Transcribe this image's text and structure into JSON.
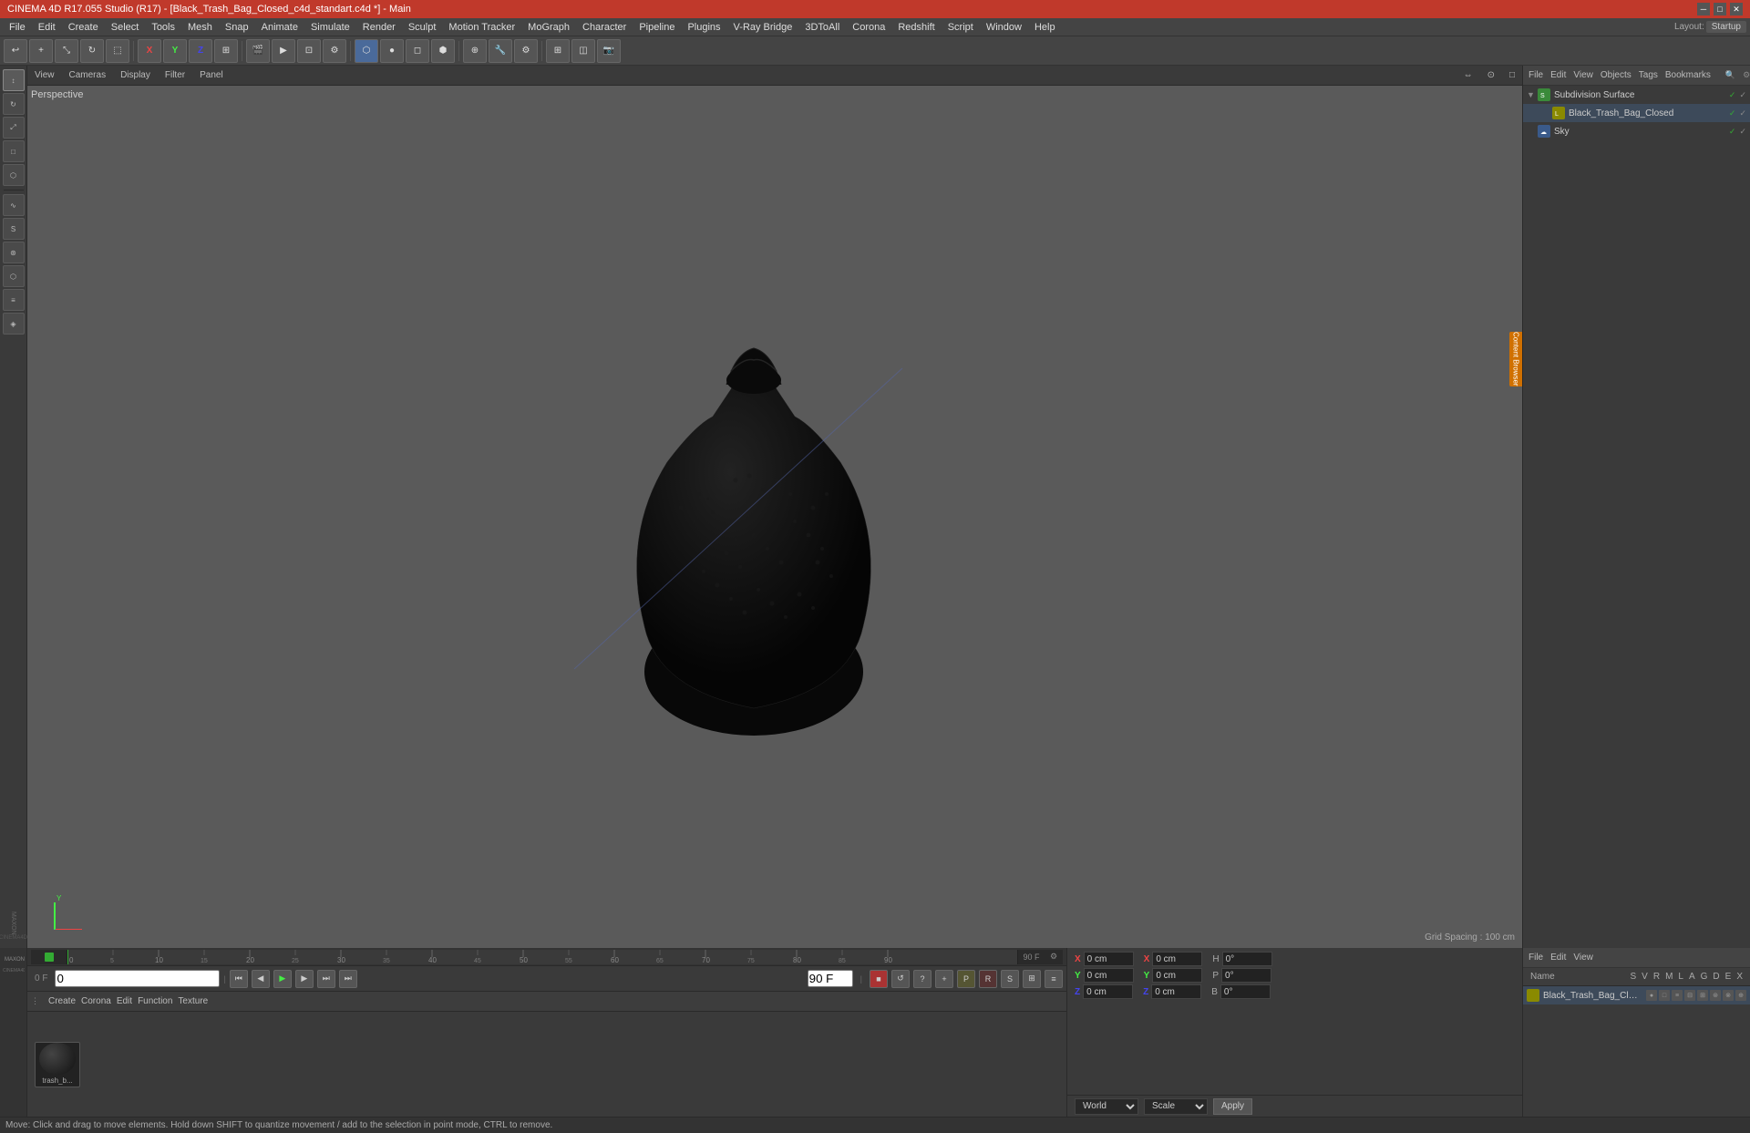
{
  "titlebar": {
    "title": "CINEMA 4D R17.055 Studio (R17) - [Black_Trash_Bag_Closed_c4d_standart.c4d *] - Main",
    "min": "─",
    "max": "□",
    "close": "✕"
  },
  "menubar": {
    "items": [
      "File",
      "Edit",
      "Create",
      "Select",
      "Tools",
      "Mesh",
      "Snap",
      "Animate",
      "Simulate",
      "Render",
      "Sculpt",
      "Motion Tracker",
      "MoGraph",
      "Character",
      "Pipeline",
      "Plugins",
      "V-Ray Bridge",
      "3DToAll",
      "Corona",
      "Redshift",
      "Script",
      "Window",
      "Help"
    ],
    "layout_label": "Layout:",
    "layout_value": "Startup"
  },
  "viewport": {
    "label": "Perspective",
    "grid_spacing": "Grid Spacing : 100 cm",
    "toolbar_items": [
      "View",
      "Cameras",
      "Display",
      "Filter",
      "Panel"
    ],
    "icons_right": [
      "⇔",
      "⊙",
      "□"
    ]
  },
  "object_manager": {
    "header_items": [
      "File",
      "Edit",
      "View",
      "Objects",
      "Tags",
      "Bookmarks"
    ],
    "objects": [
      {
        "name": "Subdivision Surface",
        "icon_color": "green",
        "indent": 0,
        "has_check": true,
        "checked": true
      },
      {
        "name": "Black_Trash_Bag_Closed",
        "icon_color": "yellow",
        "indent": 1,
        "has_check": true,
        "checked": true
      },
      {
        "name": "Sky",
        "icon_color": "blue",
        "indent": 0,
        "has_check": true,
        "checked": true
      }
    ]
  },
  "object_manager_bottom": {
    "header_items": [
      "File",
      "Edit",
      "View"
    ],
    "col_headers": [
      "Name",
      "S",
      "V",
      "R",
      "M",
      "L",
      "A",
      "G",
      "D",
      "E",
      "X"
    ],
    "rows": [
      {
        "name": "Black_Trash_Bag_Closed",
        "icon_color": "yellow"
      }
    ]
  },
  "timeline": {
    "ticks": [
      0,
      5,
      10,
      15,
      20,
      25,
      30,
      35,
      40,
      45,
      50,
      55,
      60,
      65,
      70,
      75,
      80,
      85,
      90
    ],
    "frame_start": "0 F",
    "frame_end": "90 F"
  },
  "transport": {
    "frame_current": "0 F",
    "frame_box": "0",
    "frame_end_box": "90 F"
  },
  "material_manager": {
    "toolbar_items": [
      "Create",
      "Corona",
      "Edit",
      "Function",
      "Texture"
    ],
    "materials": [
      {
        "name": "trash_b...",
        "color": "#111"
      }
    ]
  },
  "attributes": {
    "x_pos": "0 cm",
    "y_pos": "0 cm",
    "z_pos": "0 cm",
    "x_rot": "0 cm",
    "y_rot": "0 cm",
    "z_rot": "0 cm",
    "h_val": "0°",
    "p_val": "0°",
    "b_val": "0°",
    "mode_world": "World",
    "mode_scale": "Scale",
    "apply_label": "Apply"
  },
  "status_bar": {
    "text": "Move: Click and drag to move elements. Hold down SHIFT to quantize movement / add to the selection in point mode, CTRL to remove."
  },
  "sidebar": {
    "buttons": [
      "▶",
      "⊞",
      "△",
      "○",
      "⬡",
      "◈",
      "⬢",
      "S",
      "⟲",
      "⬡",
      "≡",
      "⬟"
    ]
  }
}
